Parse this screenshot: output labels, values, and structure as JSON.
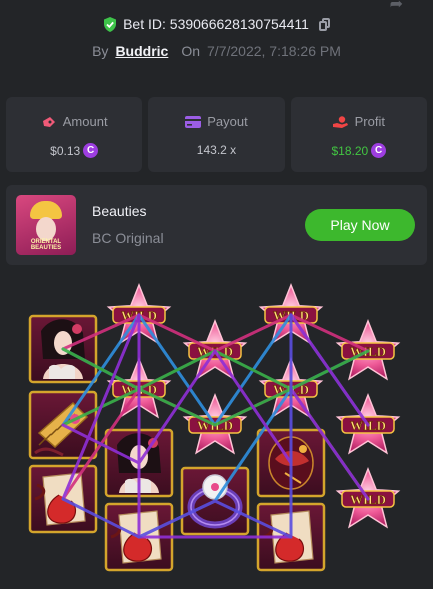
{
  "bet": {
    "label": "Bet ID: 539066628130754411",
    "by_label": "By",
    "user": "Buddric",
    "on_label": "On",
    "date": "7/7/2022, 7:18:26 PM"
  },
  "stats": [
    {
      "label": "Amount",
      "value": "$0.13",
      "icon": "bag-icon",
      "coin": true,
      "color": "#c3c5cc"
    },
    {
      "label": "Payout",
      "value": "143.2 x",
      "icon": "card-icon",
      "coin": false,
      "color": "#c3c5cc"
    },
    {
      "label": "Profit",
      "value": "$18.20",
      "icon": "hand-coin-icon",
      "coin": true,
      "color": "#42c542"
    }
  ],
  "coin_glyph": "C",
  "game": {
    "name": "Beauties",
    "provider": "BC Original",
    "thumb_text": "ORIENTAL BEAUTIES",
    "play_label": "Play Now"
  },
  "wild_text": "WILD",
  "reels": [
    [
      "lady",
      "comb",
      "dragon"
    ],
    [
      "wild",
      "wild"
    ],
    [
      "lady",
      "dragon"
    ],
    [
      "wild",
      "wild"
    ],
    [
      "ring"
    ],
    [
      "lantern",
      "dragon"
    ],
    [
      "wild",
      "wild"
    ],
    [
      "wild",
      "wild",
      "wild"
    ]
  ],
  "colors": {
    "accent_green": "#3db82d",
    "coin_purple": "#9d3ee0",
    "wild_pink": "#e84a8a",
    "frame_gold": "#d4a52c"
  }
}
